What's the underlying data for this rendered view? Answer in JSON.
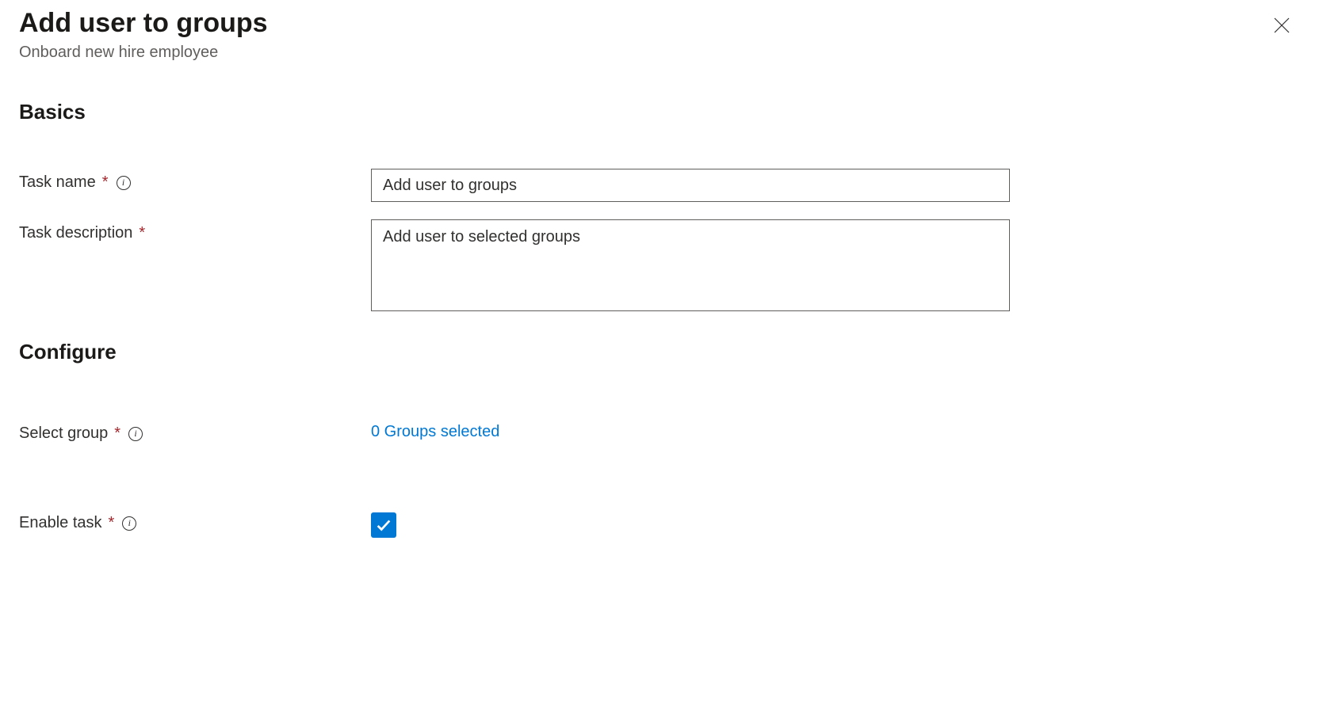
{
  "header": {
    "title": "Add user to groups",
    "subtitle": "Onboard new hire employee"
  },
  "sections": {
    "basics": "Basics",
    "configure": "Configure"
  },
  "fields": {
    "task_name": {
      "label": "Task name",
      "value": "Add user to groups"
    },
    "task_description": {
      "label": "Task description",
      "value": "Add user to selected groups"
    },
    "select_group": {
      "label": "Select group",
      "value": "0 Groups selected"
    },
    "enable_task": {
      "label": "Enable task",
      "checked": true
    }
  }
}
